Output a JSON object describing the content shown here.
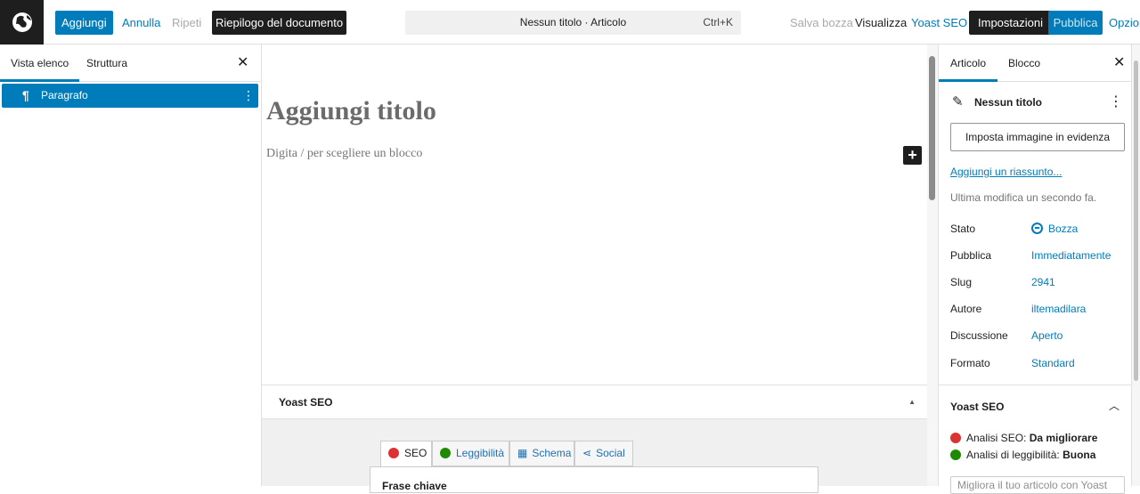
{
  "header": {
    "logo": "globe-logo",
    "add_label": "Aggiungi",
    "undo_label": "Annulla",
    "redo_label": "Ripeti",
    "overview_label": "Riepilogo del documento",
    "command_title": "Nessun titolo · Articolo",
    "command_shortcut": "Ctrl+K",
    "save_draft_label": "Salva bozza",
    "preview_label": "Visualizza",
    "yoast_label": "Yoast SEO",
    "settings_label": "Impostazioni",
    "publish_label": "Pubblica",
    "options_label": "Opzioni"
  },
  "left_panel": {
    "tabs": [
      "Vista elenco",
      "Struttura"
    ],
    "items": [
      {
        "label": "Paragrafo",
        "icon": "paragraph-icon"
      }
    ]
  },
  "editor": {
    "title_placeholder": "Aggiungi titolo",
    "block_placeholder": "Digita / per scegliere un blocco",
    "add_block_icon": "plus-icon"
  },
  "yoast_panel": {
    "title": "Yoast SEO",
    "tabs": [
      {
        "label": "SEO",
        "icon": "sad-face-icon",
        "color": "#dc3232"
      },
      {
        "label": "Leggibilità",
        "icon": "smile-face-icon",
        "color": "#1e8a00"
      },
      {
        "label": "Schema",
        "icon": "grid-icon"
      },
      {
        "label": "Social",
        "icon": "share-icon"
      }
    ],
    "focus_label": "Frase chiave"
  },
  "sidebar": {
    "tabs": [
      "Articolo",
      "Blocco"
    ],
    "post_title": "Nessun titolo",
    "featured_image_label": "Imposta immagine in evidenza",
    "excerpt_link": "Aggiungi un riassunto...",
    "last_modified": "Ultima modifica un secondo fa.",
    "meta": [
      {
        "key": "Stato",
        "value": "Bozza"
      },
      {
        "key": "Pubblica",
        "value": "Immediatamente"
      },
      {
        "key": "Slug",
        "value": "2941"
      },
      {
        "key": "Autore",
        "value": "iltemadilara"
      },
      {
        "key": "Discussione",
        "value": "Aperto"
      },
      {
        "key": "Formato",
        "value": "Standard"
      }
    ],
    "yoast": {
      "title": "Yoast SEO",
      "seo_label": "Analisi SEO:",
      "seo_value": "Da migliorare",
      "readability_label": "Analisi di leggibilità:",
      "readability_value": "Buona",
      "input_placeholder": "Migliora il tuo articolo con Yoast"
    }
  },
  "colors": {
    "accent": "#007cba",
    "dark": "#1e1e1e"
  }
}
